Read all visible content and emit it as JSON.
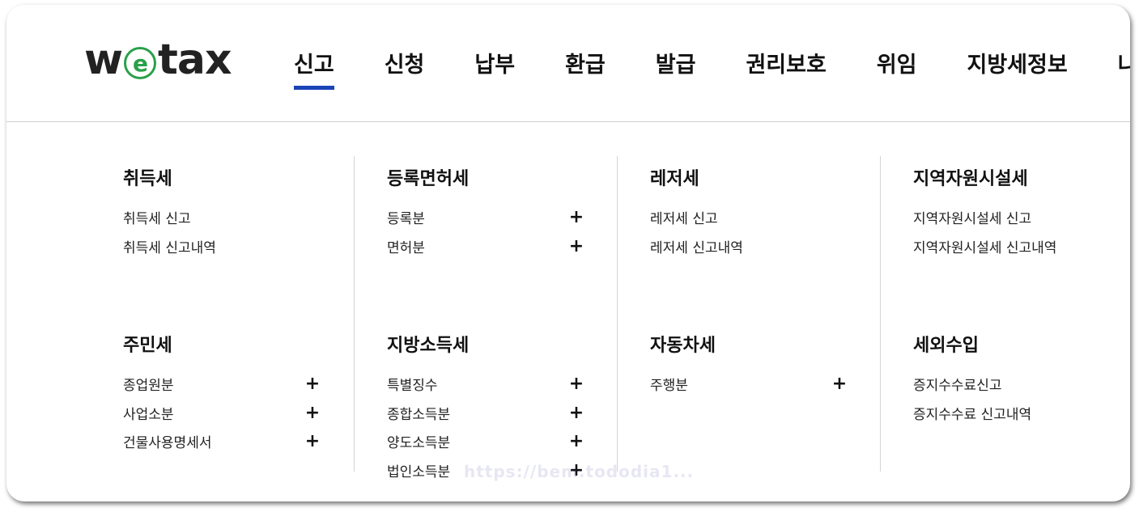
{
  "logo": {
    "w": "w",
    "e": "e",
    "tail": "tax"
  },
  "nav": [
    {
      "label": "신고",
      "active": true
    },
    {
      "label": "신청"
    },
    {
      "label": "납부"
    },
    {
      "label": "환급"
    },
    {
      "label": "발급"
    },
    {
      "label": "권리보호"
    },
    {
      "label": "위임"
    },
    {
      "label": "지방세정보"
    },
    {
      "label": "나"
    }
  ],
  "columns": [
    {
      "top": {
        "title": "취득세",
        "items": [
          {
            "label": "취득세 신고"
          },
          {
            "label": "취득세 신고내역"
          }
        ]
      },
      "bottom": {
        "title": "주민세",
        "items": [
          {
            "label": "종업원분",
            "expand": "+"
          },
          {
            "label": "사업소분",
            "expand": "+"
          },
          {
            "label": "건물사용명세서",
            "expand": "+"
          }
        ]
      }
    },
    {
      "top": {
        "title": "등록면허세",
        "items": [
          {
            "label": "등록분",
            "expand": "+"
          },
          {
            "label": "면허분",
            "expand": "+"
          }
        ]
      },
      "bottom": {
        "title": "지방소득세",
        "items": [
          {
            "label": "특별징수",
            "expand": "+"
          },
          {
            "label": "종합소득분",
            "expand": "+"
          },
          {
            "label": "양도소득분",
            "expand": "+"
          },
          {
            "label": "법인소득분",
            "expand": "+"
          }
        ]
      }
    },
    {
      "top": {
        "title": "레저세",
        "items": [
          {
            "label": "레저세 신고"
          },
          {
            "label": "레저세 신고내역"
          }
        ]
      },
      "bottom": {
        "title": "자동차세",
        "items": [
          {
            "label": "주행분",
            "expand": "+"
          }
        ]
      }
    },
    {
      "top": {
        "title": "지역자원시설세",
        "items": [
          {
            "label": "지역자원시설세 신고"
          },
          {
            "label": "지역자원시설세 신고내역"
          }
        ]
      },
      "bottom": {
        "title": "세외수입",
        "items": [
          {
            "label": "증지수수료신고"
          },
          {
            "label": "증지수수료 신고내역"
          }
        ]
      }
    }
  ],
  "watermark": "https://bem.tododia1..."
}
